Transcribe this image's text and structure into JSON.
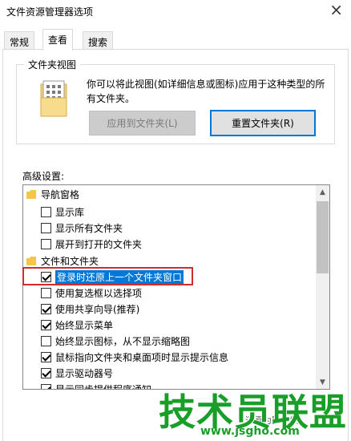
{
  "window": {
    "title": "文件资源管理器选项",
    "close_glyph": "×"
  },
  "tabs": [
    {
      "label": "常规"
    },
    {
      "label": "查看"
    },
    {
      "label": "搜索"
    }
  ],
  "folder_view": {
    "group_label": "文件夹视图",
    "description": "你可以将此视图(如详细信息或图标)应用于这种类型的所有文件夹。",
    "apply_button": "应用到文件夹(L)",
    "reset_button": "重置文件夹(R)"
  },
  "advanced": {
    "label": "高级设置:",
    "items": [
      {
        "type": "folder",
        "label": "导航窗格"
      },
      {
        "type": "checkbox",
        "label": "显示库",
        "checked": false
      },
      {
        "type": "checkbox",
        "label": "显示所有文件夹",
        "checked": false
      },
      {
        "type": "checkbox",
        "label": "展开到打开的文件夹",
        "checked": false
      },
      {
        "type": "folder",
        "label": "文件和文件夹"
      },
      {
        "type": "checkbox",
        "label": "登录时还原上一个文件夹窗口",
        "checked": true,
        "selected": true
      },
      {
        "type": "checkbox",
        "label": "使用复选框以选择项",
        "checked": false
      },
      {
        "type": "checkbox",
        "label": "使用共享向导(推荐)",
        "checked": true
      },
      {
        "type": "checkbox",
        "label": "始终显示菜单",
        "checked": true
      },
      {
        "type": "checkbox",
        "label": "始终显示图标，从不显示缩略图",
        "checked": false
      },
      {
        "type": "checkbox",
        "label": "鼠标指向文件夹和桌面项时显示提示信息",
        "checked": true
      },
      {
        "type": "checkbox",
        "label": "显示驱动器号",
        "checked": true
      },
      {
        "type": "checkbox",
        "label": "显示同步提供程序通知",
        "checked": true
      }
    ]
  },
  "bottom": {
    "partial_text": "还原为默认值"
  },
  "watermark": {
    "brand": "技术员联盟",
    "url": "www.jsgho.com"
  },
  "colors": {
    "accent": "#0078d7",
    "highlight_border": "#d22c2c",
    "watermark": "#1a9e2a"
  }
}
